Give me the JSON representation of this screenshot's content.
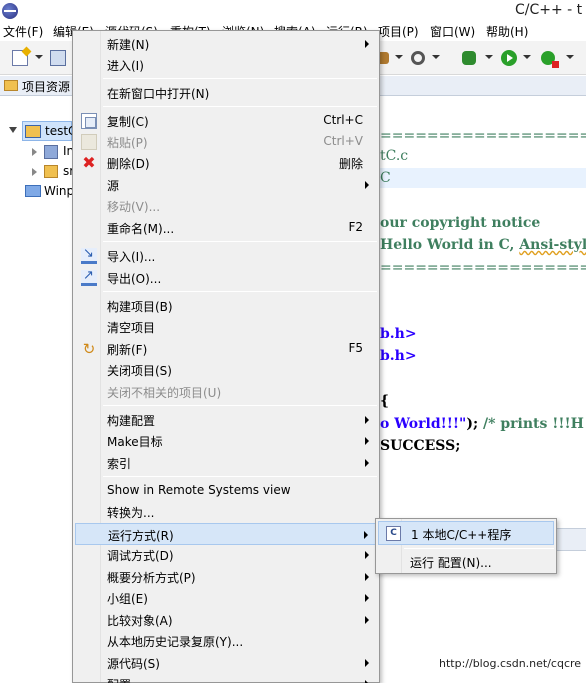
{
  "window": {
    "title": "C/C++ - t"
  },
  "menubar": {
    "items": [
      {
        "label": "文件(F)"
      },
      {
        "label": "编辑(E)"
      },
      {
        "label": "源代码(S)"
      },
      {
        "label": "重构(T)"
      },
      {
        "label": "浏览(N)"
      },
      {
        "label": "搜索(A)"
      },
      {
        "label": "运行(R)"
      },
      {
        "label": "项目(P)"
      },
      {
        "label": "窗口(W)"
      },
      {
        "label": "帮助(H)"
      }
    ]
  },
  "explorer": {
    "tab_label": "项目资源",
    "tree": [
      {
        "label": "testC",
        "icon": "project-icon"
      },
      {
        "label": "In",
        "icon": "includes-icon"
      },
      {
        "label": "sr",
        "icon": "source-folder-icon"
      },
      {
        "label": "Winp",
        "icon": "folder-icon"
      }
    ]
  },
  "editor": {
    "lines": [
      {
        "text": "====================",
        "kind": "comment"
      },
      {
        "text": "tC.c",
        "kind": "comment"
      },
      {
        "text": "C",
        "kind": "comment"
      },
      {
        "text": "our copyright notice",
        "kind": "comment"
      },
      {
        "text": "Hello World in C, ",
        "kind": "comment"
      },
      {
        "text": "Ansi-style",
        "kind": "comment-squiggle"
      },
      {
        "text": "====================",
        "kind": "comment"
      },
      {
        "text": "b.h>",
        "kind": "include"
      },
      {
        "text": "b.h>",
        "kind": "include"
      },
      {
        "text": "{",
        "kind": "plain"
      },
      {
        "text": "o World!!!\"",
        "kind": "string"
      },
      {
        "text": "); ",
        "kind": "plain"
      },
      {
        "text": "/* prints !!!H",
        "kind": "comment"
      },
      {
        "text": "SUCCESS;",
        "kind": "plain"
      }
    ]
  },
  "context_menu": {
    "items": [
      {
        "label": "新建(N)",
        "shortcut": "",
        "submenu": true,
        "disabled": false,
        "icon": ""
      },
      {
        "label": "进入(I)",
        "shortcut": "",
        "submenu": false,
        "disabled": false,
        "icon": ""
      },
      {
        "label": "在新窗口中打开(N)",
        "shortcut": "",
        "submenu": false,
        "disabled": false,
        "icon": ""
      },
      {
        "label": "复制(C)",
        "shortcut": "Ctrl+C",
        "submenu": false,
        "disabled": false,
        "icon": "copy-icon"
      },
      {
        "label": "粘贴(P)",
        "shortcut": "Ctrl+V",
        "submenu": false,
        "disabled": true,
        "icon": "paste-icon"
      },
      {
        "label": "删除(D)",
        "shortcut": "删除",
        "submenu": false,
        "disabled": false,
        "icon": "delete-icon"
      },
      {
        "label": "源",
        "shortcut": "",
        "submenu": true,
        "disabled": false,
        "icon": ""
      },
      {
        "label": "移动(V)...",
        "shortcut": "",
        "submenu": false,
        "disabled": true,
        "icon": ""
      },
      {
        "label": "重命名(M)...",
        "shortcut": "F2",
        "submenu": false,
        "disabled": false,
        "icon": ""
      },
      {
        "label": "导入(I)...",
        "shortcut": "",
        "submenu": false,
        "disabled": false,
        "icon": "import-icon"
      },
      {
        "label": "导出(O)...",
        "shortcut": "",
        "submenu": false,
        "disabled": false,
        "icon": "export-icon"
      },
      {
        "label": "构建项目(B)",
        "shortcut": "",
        "submenu": false,
        "disabled": false,
        "icon": ""
      },
      {
        "label": "清空项目",
        "shortcut": "",
        "submenu": false,
        "disabled": false,
        "icon": ""
      },
      {
        "label": "刷新(F)",
        "shortcut": "F5",
        "submenu": false,
        "disabled": false,
        "icon": "refresh-icon"
      },
      {
        "label": "关闭项目(S)",
        "shortcut": "",
        "submenu": false,
        "disabled": false,
        "icon": ""
      },
      {
        "label": "关闭不相关的项目(U)",
        "shortcut": "",
        "submenu": false,
        "disabled": true,
        "icon": ""
      },
      {
        "label": "构建配置",
        "shortcut": "",
        "submenu": true,
        "disabled": false,
        "icon": ""
      },
      {
        "label": "Make目标",
        "shortcut": "",
        "submenu": true,
        "disabled": false,
        "icon": ""
      },
      {
        "label": "索引",
        "shortcut": "",
        "submenu": true,
        "disabled": false,
        "icon": ""
      },
      {
        "label": "Show in Remote Systems view",
        "shortcut": "",
        "submenu": false,
        "disabled": false,
        "icon": ""
      },
      {
        "label": "转换为...",
        "shortcut": "",
        "submenu": false,
        "disabled": false,
        "icon": ""
      },
      {
        "label": "运行方式(R)",
        "shortcut": "",
        "submenu": true,
        "disabled": false,
        "icon": "",
        "hover": true
      },
      {
        "label": "调试方式(D)",
        "shortcut": "",
        "submenu": true,
        "disabled": false,
        "icon": ""
      },
      {
        "label": "概要分析方式(P)",
        "shortcut": "",
        "submenu": true,
        "disabled": false,
        "icon": ""
      },
      {
        "label": "小组(E)",
        "shortcut": "",
        "submenu": true,
        "disabled": false,
        "icon": ""
      },
      {
        "label": "比较对象(A)",
        "shortcut": "",
        "submenu": true,
        "disabled": false,
        "icon": ""
      },
      {
        "label": "从本地历史记录复原(Y)...",
        "shortcut": "",
        "submenu": false,
        "disabled": false,
        "icon": ""
      },
      {
        "label": "源代码(S)",
        "shortcut": "",
        "submenu": true,
        "disabled": false,
        "icon": ""
      },
      {
        "label": "配置",
        "shortcut": "",
        "submenu": true,
        "disabled": false,
        "icon": ""
      }
    ]
  },
  "submenu": {
    "items": [
      {
        "label": "1 本地C/C++程序",
        "icon_text": "C"
      },
      {
        "label": "运行 配置(N)...",
        "icon_text": ""
      }
    ]
  },
  "watermark": "http://blog.csdn.net/cqcre"
}
